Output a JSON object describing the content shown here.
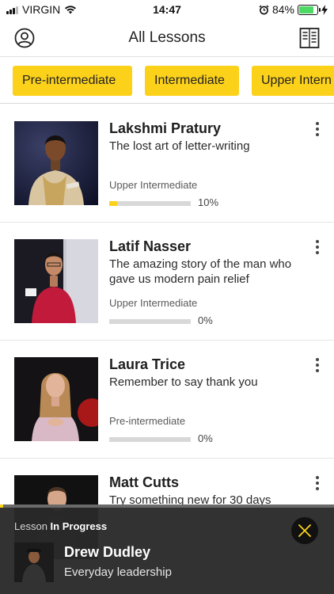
{
  "status_bar": {
    "carrier": "VIRGIN",
    "time": "14:47",
    "battery_pct_text": "84%",
    "battery_level": 0.84,
    "battery_color": "#4cd964"
  },
  "nav": {
    "title": "All Lessons",
    "left_icon": "profile-icon",
    "right_icon": "notebook-icon"
  },
  "filters": [
    {
      "label": "Pre-intermediate"
    },
    {
      "label": "Intermediate"
    },
    {
      "label": "Upper Intern"
    }
  ],
  "lessons": [
    {
      "speaker": "Lakshmi Pratury",
      "title": "The lost art of letter-writing",
      "level": "Upper Intermediate",
      "progress_text": "10%",
      "progress": 0.1
    },
    {
      "speaker": "Latif Nasser",
      "title": "The amazing story of the man who gave us modern pain relief",
      "level": "Upper Intermediate",
      "progress_text": "0%",
      "progress": 0.0
    },
    {
      "speaker": "Laura Trice",
      "title": "Remember to say thank you",
      "level": "Pre-intermediate",
      "progress_text": "0%",
      "progress": 0.0
    },
    {
      "speaker": "Matt Cutts",
      "title": "Try something new for 30 days",
      "level": "",
      "progress_text": "",
      "progress": 0.0
    }
  ],
  "player": {
    "label_prefix": "Lesson",
    "label_bold": "In Progress",
    "speaker": "Drew Dudley",
    "title": "Everyday leadership",
    "progress": 0.01
  },
  "colors": {
    "accent": "#fcd11a",
    "player_bg": "#2a2a2a"
  }
}
